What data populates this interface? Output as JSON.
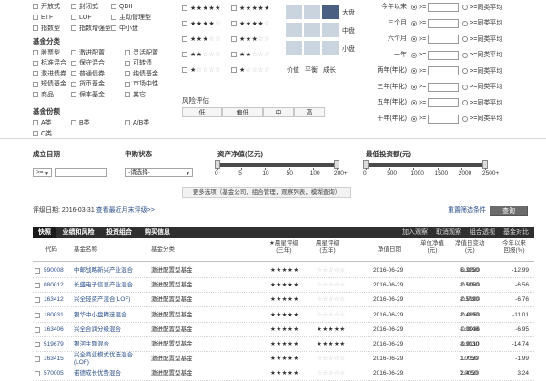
{
  "fund_type_options": {
    "col1": [
      "开放式",
      "ETF",
      "指数型"
    ],
    "col2": [
      "封闭式",
      "LOF",
      "指数增强型"
    ],
    "col3": [
      "QDII",
      "主动管理型",
      "中小盘"
    ]
  },
  "category": {
    "title": "基金分类",
    "col1": [
      "股票型",
      "标准混合",
      "激进债券",
      "短债基金",
      "商品"
    ],
    "col2": [
      "激进配置",
      "保守混合",
      "普通债券",
      "货币基金",
      "保本基金"
    ],
    "col3": [
      "灵活配置",
      "可转债",
      "纯债基金",
      "市场中性",
      "其它"
    ]
  },
  "share_class": {
    "title": "基金份额",
    "items": [
      "A类",
      "B类",
      "A/B类",
      "C类"
    ]
  },
  "rating_stars": {
    "col1": [
      "★★★★★",
      "★★★★☆",
      "★★★☆☆",
      "★★☆☆☆",
      "★☆☆☆☆"
    ],
    "col2": [
      "★★★★★",
      "★★★★☆",
      "★★★☆☆",
      "★★☆☆☆",
      "★☆☆☆☆"
    ]
  },
  "style_box": {
    "rows": [
      "大盘",
      "中盘",
      "小盘"
    ],
    "cols": [
      "价值",
      "平衡",
      "成长"
    ]
  },
  "risk": {
    "title": "风险评估",
    "levels": [
      "低",
      "偏低",
      "中",
      "高"
    ]
  },
  "performance": {
    "periods": [
      "今年以来",
      "三个月",
      "六个月",
      "一年",
      "两年(年化)",
      "三年(年化)",
      "五年(年化)",
      "十年(年化)"
    ],
    "op": ">=",
    "suffix": "同类平均"
  },
  "establish": {
    "title": "成立日期",
    "op": ">="
  },
  "purchase": {
    "title": "申购状态",
    "select": "-请选择-"
  },
  "nav_slider": {
    "title": "资产净值(亿元)",
    "ticks": [
      "0",
      "5",
      "10",
      "50",
      "100",
      "200+"
    ],
    "range": [
      0,
      200
    ]
  },
  "min_invest": {
    "title": "最低投资额(元)",
    "ticks": [
      "0",
      "500",
      "1000",
      "1500",
      "2000",
      "2500+"
    ],
    "range": [
      0,
      2500
    ]
  },
  "more_options": "更多选项（基金公司，组合管理，观察列表，模糊查询）",
  "rating_date": {
    "label": "评级日期:",
    "date": "2016-03-31",
    "link": "查看最近月末评级>>"
  },
  "reset_button": "重置筛选条件",
  "query_button": "查询",
  "tabs": [
    "快照",
    "业绩和风险",
    "投资组合",
    "购买信息"
  ],
  "tab_actions": [
    "加入观察",
    "取消观察",
    "组合透视",
    "基金对比"
  ],
  "table": {
    "headers": {
      "code": "代码",
      "name": "基金名称",
      "category": "基金分类",
      "rating3": "★晨星评级\n(三年)",
      "rating5": "晨星评级\n(五年)",
      "nav_date": "净值日期",
      "nav": "单位净值\n(元)",
      "change": "净值日变动\n(元)",
      "ytd": "今年以来\n回报(%)"
    },
    "rows": [
      {
        "code": "590008",
        "name": "中邮战略新兴产业混合",
        "category": "激进配置型基金",
        "r3": "★★★★★",
        "r5": "☆☆☆☆☆",
        "date": "2016-06-29",
        "nav": "5.3250",
        "chg": "-0.0280",
        "ytd": "-12.99"
      },
      {
        "code": "080012",
        "name": "长盛电子信息产业混合",
        "category": "激进配置型基金",
        "r3": "★★★★★",
        "r5": "☆☆☆☆☆",
        "date": "2016-06-29",
        "nav": "2.5350",
        "chg": "-0.0080",
        "ytd": "-6.56"
      },
      {
        "code": "163412",
        "name": "兴全轻资产混合(LOF)",
        "category": "激进配置型基金",
        "r3": "★★★★★",
        "r5": "☆☆☆☆☆",
        "date": "2016-06-29",
        "nav": "2.5790",
        "chg": "-0.0100",
        "ytd": "-6.76"
      },
      {
        "code": "180031",
        "name": "银华中小盘精选混合",
        "category": "激进配置型基金",
        "r3": "★★★★★",
        "r5": "☆☆☆☆☆",
        "date": "2016-06-29",
        "nav": "2.4390",
        "chg": "-0.0150",
        "ytd": "-11.01"
      },
      {
        "code": "163406",
        "name": "兴全合润分级混合",
        "category": "激进配置型基金",
        "r3": "★★★★★",
        "r5": "★★★★★",
        "date": "2016-06-29",
        "nav": "1.0848",
        "chg": "-0.0036",
        "ytd": "-6.95"
      },
      {
        "code": "519679",
        "name": "银河主题混合",
        "category": "激进配置型基金",
        "r3": "★★★★★",
        "r5": "★★★★★",
        "date": "2016-06-29",
        "nav": "3.9030",
        "chg": "-0.0110",
        "ytd": "-14.74"
      },
      {
        "code": "163415",
        "name": "兴全商业模式优选混合\n(LOF)",
        "category": "激进配置型基金",
        "r3": "★★★★★",
        "r5": "☆☆☆☆☆",
        "date": "2016-06-29",
        "nav": "1.7230",
        "chg": "0.0050",
        "ytd": "-1.99"
      },
      {
        "code": "570005",
        "name": "诺德成长优势混合",
        "category": "激进配置型基金",
        "r3": "★★★★★",
        "r5": "☆☆☆☆☆",
        "date": "2016-06-29",
        "nav": "2.4220",
        "chg": "0.0050",
        "ytd": "3.24"
      }
    ]
  }
}
